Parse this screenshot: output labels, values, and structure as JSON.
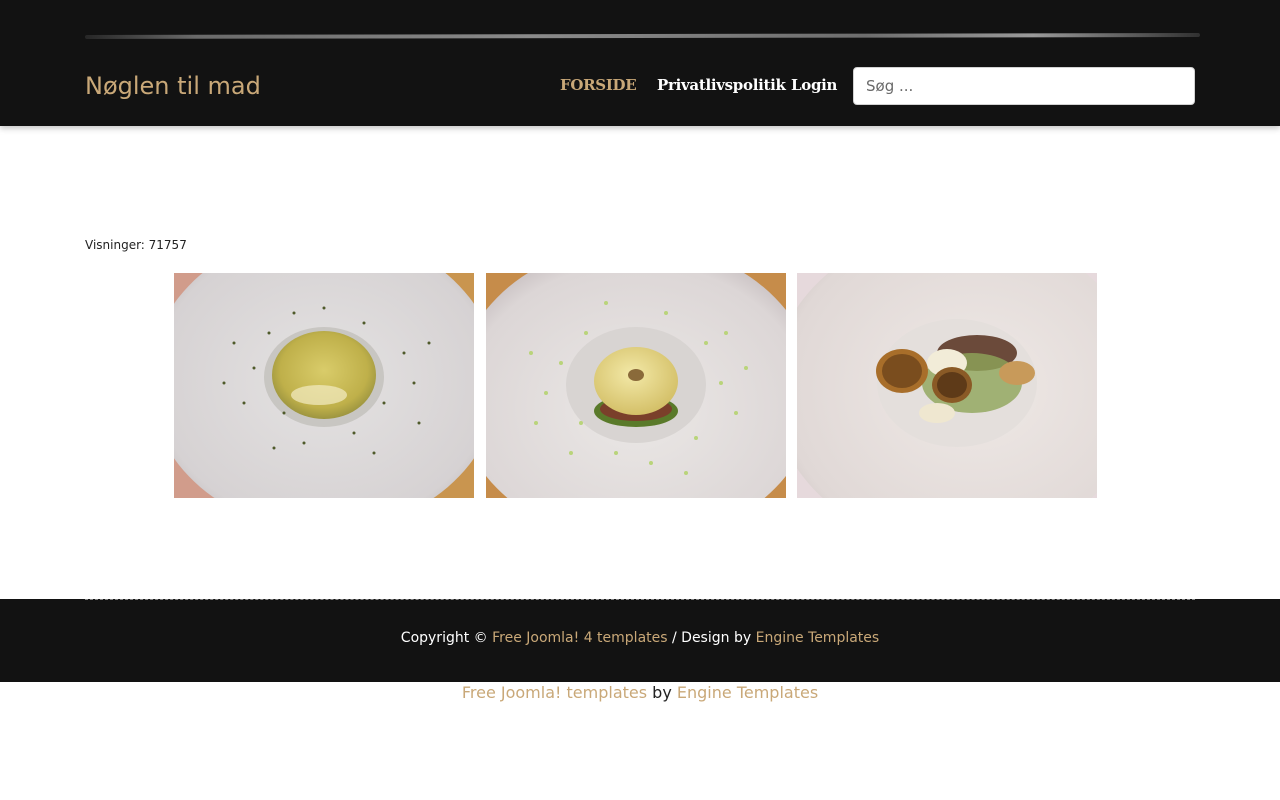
{
  "site": {
    "brand": "Nøglen til mad"
  },
  "nav": {
    "items": [
      {
        "label": "FORSIDE",
        "active": true
      },
      {
        "label": "Privatlivspolitik",
        "active": false
      },
      {
        "label": "Login",
        "active": false
      }
    ]
  },
  "search": {
    "placeholder": "Søg ...",
    "value": ""
  },
  "article": {
    "hits": "Visninger: 71757"
  },
  "gallery": [
    {
      "alt": "soup-plate-photo"
    },
    {
      "alt": "ravioli-plate-photo"
    },
    {
      "alt": "potato-plate-photo"
    }
  ],
  "footer": {
    "copyright_prefix": "Copyright ©",
    "link1": "Free Joomla! 4 templates",
    "separator": "/ Design by",
    "link2": "Engine Templates"
  },
  "bottom": {
    "link1": "Free Joomla! templates",
    "separator": "by",
    "link2": "Engine Templates"
  },
  "colors": {
    "accent": "#c9a878",
    "header_bg": "#121212",
    "page_bg": "#ffffff"
  }
}
